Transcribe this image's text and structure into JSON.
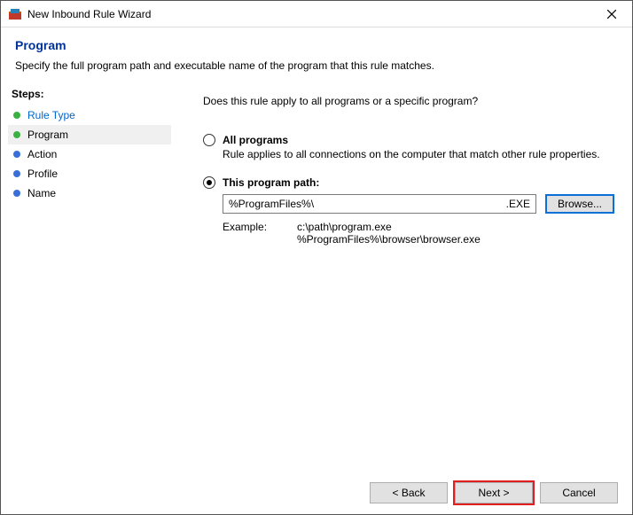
{
  "window": {
    "title": "New Inbound Rule Wizard"
  },
  "header": {
    "title": "Program",
    "description": "Specify the full program path and executable name of the program that this rule matches."
  },
  "sidebar": {
    "title": "Steps:",
    "items": [
      {
        "label": "Rule Type",
        "state": "done-link"
      },
      {
        "label": "Program",
        "state": "current"
      },
      {
        "label": "Action",
        "state": "pending"
      },
      {
        "label": "Profile",
        "state": "pending"
      },
      {
        "label": "Name",
        "state": "pending"
      }
    ]
  },
  "main": {
    "question": "Does this rule apply to all programs or a specific program?",
    "option_all": {
      "label": "All programs",
      "desc": "Rule applies to all connections on the computer that match other rule properties."
    },
    "option_path": {
      "label": "This program path:",
      "value": "%ProgramFiles%\\",
      "ext": ".EXE",
      "browse": "Browse...",
      "example_label": "Example:",
      "example1": "c:\\path\\program.exe",
      "example2": "%ProgramFiles%\\browser\\browser.exe"
    }
  },
  "footer": {
    "back": "< Back",
    "next": "Next >",
    "cancel": "Cancel"
  }
}
